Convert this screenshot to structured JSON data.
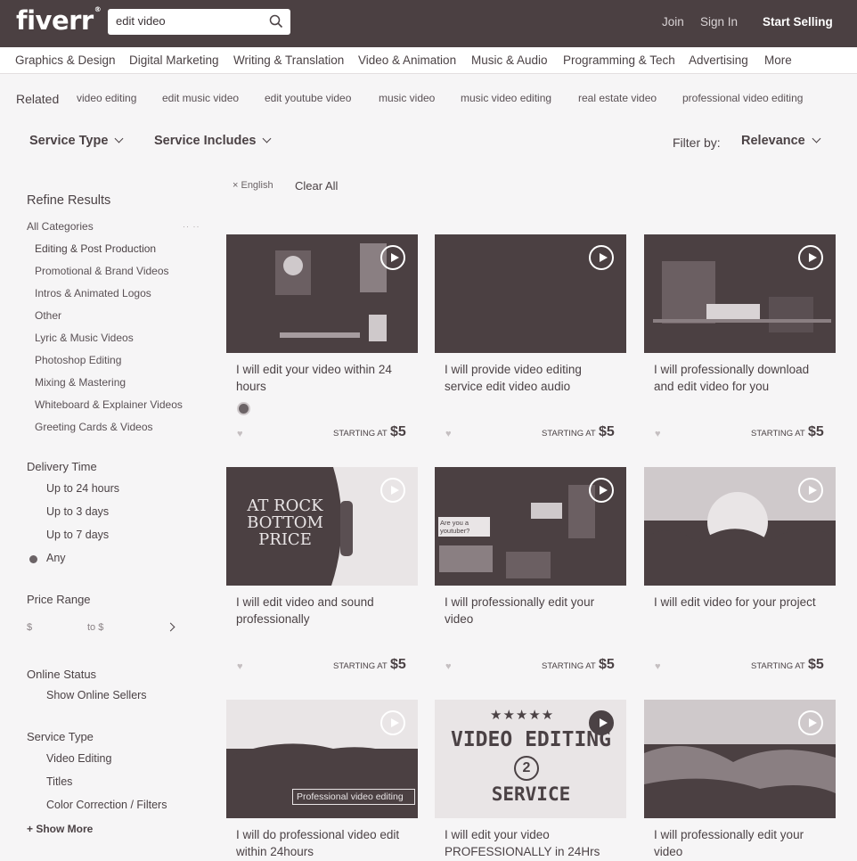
{
  "header": {
    "logo": "fiverr",
    "logo_mark": "®",
    "search_value": "edit video",
    "search_icon": "search-icon",
    "join": "Join",
    "sign_in": "Sign In",
    "start_selling": "Start Selling"
  },
  "categories": [
    "Graphics & Design",
    "Digital Marketing",
    "Writing & Translation",
    "Video & Animation",
    "Music & Audio",
    "Programming & Tech",
    "Advertising",
    "More"
  ],
  "related": {
    "label": "Related",
    "tags": [
      "video editing",
      "edit music video",
      "edit youtube video",
      "music video",
      "music video editing",
      "real estate video",
      "professional video editing"
    ]
  },
  "filters": {
    "service_type": "Service Type",
    "service_includes": "Service Includes",
    "filter_by_label": "Filter by:",
    "filter_by_value": "Relevance",
    "active_chip": "× English",
    "clear_all": "Clear All"
  },
  "sidebar": {
    "title": "Refine Results",
    "all_categories": "All Categories",
    "categories": [
      "Editing & Post Production",
      "Promotional & Brand Videos",
      "Intros & Animated Logos",
      "Other",
      "Lyric & Music Videos",
      "Photoshop Editing",
      "Mixing & Mastering",
      "Whiteboard & Explainer Videos",
      "Greeting Cards & Videos"
    ],
    "delivery_title": "Delivery Time",
    "delivery_options": [
      "Up to 24 hours",
      "Up to 3 days",
      "Up to 7 days",
      "Any"
    ],
    "price_title": "Price Range",
    "price_min": "$",
    "price_to": "to $",
    "online_title": "Online Status",
    "online_option": "Show Online Sellers",
    "service_title": "Service Type",
    "service_options": [
      "Video Editing",
      "Titles",
      "Color Correction / Filters"
    ],
    "show_more": "+ Show More"
  },
  "gigs": [
    {
      "title": "I will edit your video within 24 hours",
      "starting": "STARTING AT",
      "price": "$5"
    },
    {
      "title": "I will provide video editing service edit video audio",
      "starting": "STARTING AT",
      "price": "$5"
    },
    {
      "title": "I will professionally download and edit video for you",
      "starting": "STARTING AT",
      "price": "$5"
    },
    {
      "title": "I will edit video and sound professionally",
      "starting": "STARTING AT",
      "price": "$5",
      "thumb_text": "AT ROCK BOTTOM PRICE"
    },
    {
      "title": "I will professionally edit your video",
      "starting": "STARTING AT",
      "price": "$5",
      "thumb_text": "Are you a youtuber?"
    },
    {
      "title": "I will edit video for your project",
      "starting": "STARTING AT",
      "price": "$5"
    },
    {
      "title": "I will do professional video edit within 24hours",
      "thumb_text": "Professional video editing"
    },
    {
      "title": "I will edit your video PROFESSIONALLY in 24Hrs",
      "thumb_text": "VIDEO EDITING",
      "thumb_text2": "SERVICE"
    },
    {
      "title": "I will professionally edit your video"
    }
  ],
  "colors": {
    "header_bg": "#4b4042",
    "text": "#4b4245",
    "thumb": "#4b4042"
  }
}
